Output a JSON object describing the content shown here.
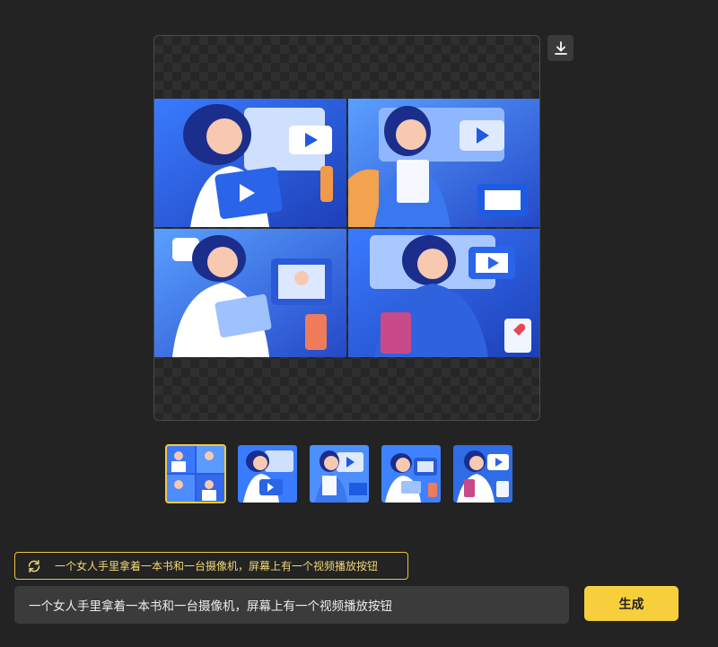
{
  "preview": {
    "image_label": "main-generated-image"
  },
  "toolbar": {
    "download_icon": "download-icon"
  },
  "thumbnails": [
    {
      "selected": true
    },
    {
      "selected": false
    },
    {
      "selected": false
    },
    {
      "selected": false
    },
    {
      "selected": false
    }
  ],
  "suggestion": {
    "icon": "refresh-icon",
    "text": "一个女人手里拿着一本书和一台摄像机，屏幕上有一个视频播放按钮"
  },
  "prompt": {
    "value": "一个女人手里拿着一本书和一台摄像机，屏幕上有一个视频播放按钮"
  },
  "actions": {
    "generate_label": "生成"
  },
  "colors": {
    "background": "#232323",
    "accent": "#f7cf3c",
    "suggestion_border": "#e9c445",
    "art_blue": "#2f6ce6"
  }
}
